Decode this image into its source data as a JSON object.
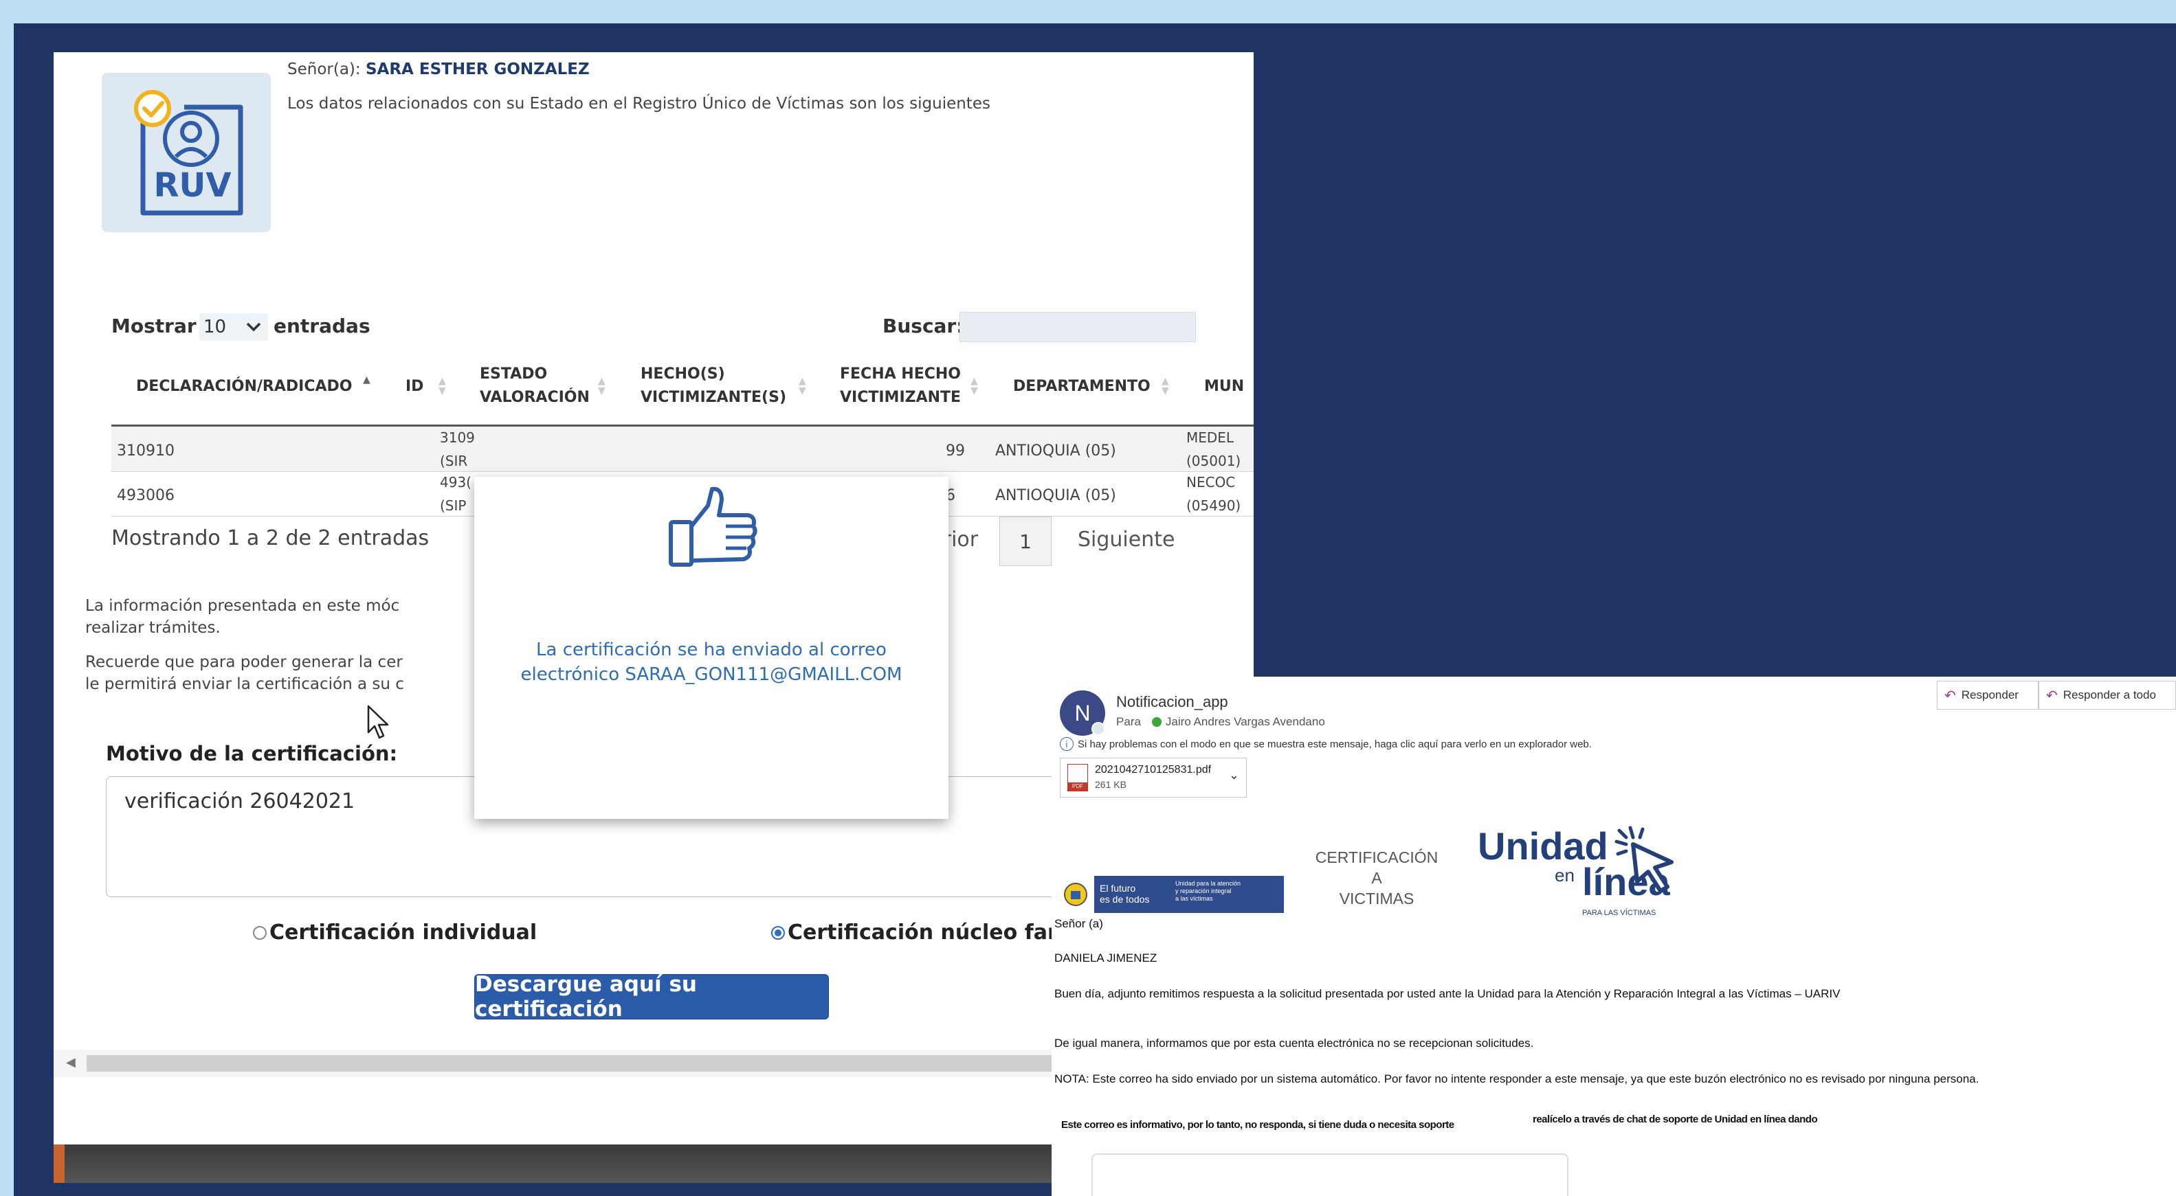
{
  "ruv": {
    "greeting_prefix": "Señor(a):",
    "person_name": "SARA ESTHER GONZALEZ",
    "intro_text": "Los datos relacionados con su Estado en el Registro Único de Víctimas son los siguientes",
    "logo_text": "RUV",
    "show_label": "Mostrar",
    "show_value": "10",
    "entries_label": "entradas",
    "search_label": "Buscar:",
    "search_value": "",
    "columns": [
      {
        "line1": "DECLARACIÓN/RADICADO",
        "line2": ""
      },
      {
        "line1": "ID",
        "line2": ""
      },
      {
        "line1": "ESTADO",
        "line2": "VALORACIÓN"
      },
      {
        "line1": "HECHO(S)",
        "line2": "VICTIMIZANTE(S)"
      },
      {
        "line1": "FECHA HECHO",
        "line2": "VICTIMIZANTE"
      },
      {
        "line1": "DEPARTAMENTO",
        "line2": ""
      },
      {
        "line1": "MUN",
        "line2": ""
      }
    ],
    "rows": [
      {
        "radicado": "310910",
        "id_line1": "3109",
        "id_line2": "(SIR",
        "fecha": "99",
        "departamento": "ANTIOQUIA (05)",
        "mun_line1": "MEDEL",
        "mun_line2": "(05001)"
      },
      {
        "radicado": "493006",
        "id_line1": "493(",
        "id_line2": "(SIP",
        "fecha": "6",
        "departamento": "ANTIOQUIA (05)",
        "mun_line1": "NECOC",
        "mun_line2": "(05490)"
      }
    ],
    "showing_text": "Mostrando 1 a 2 de 2 entradas",
    "pagination": {
      "prev": "Anterior",
      "page": "1",
      "next": "Siguiente"
    },
    "note1_line1": "La información presentada en este móc                                                   onstituye un documento viable para",
    "note1_line2": "realizar trámites.",
    "note2_line1": "Recuerde que para poder generar la cer                                                   electrónico actualizados, este último",
    "note2_line2": "le permitirá enviar la certificación a su c",
    "motive_label": "Motivo de la certificación:",
    "motive_value": "verificación 26042021",
    "radio_individual": "Certificación individual",
    "radio_family": "Certificación núcleo famili",
    "download_button": "Descargue aquí su certificación"
  },
  "modal": {
    "message_line1": "La certificación se ha enviado al correo",
    "message_line2": "electrónico SARAA_GON111@GMAILL.COM"
  },
  "email": {
    "avatar_initial": "N",
    "sender": "Notificacion_app",
    "to_label": "Para",
    "recipient": "Jairo Andres Vargas Avendano",
    "reply_label": "Responder",
    "reply_all_label": "Responder a todo",
    "warning": "Si hay problemas con el modo en que se muestra este mensaje, haga clic aquí para verlo en un explorador web.",
    "attachment_name": "2021042710125831.pdf",
    "attachment_size": "261 KB",
    "banner_line1": "El futuro",
    "banner_line2": "es de todos",
    "banner_sub1": "Unidad para la atención",
    "banner_sub2": "y reparación integral",
    "banner_sub3": "a las víctimas",
    "cert_title_line1": "CERTIFICACIÓN A",
    "cert_title_line2": "VICTIMAS",
    "logo_unidad": "Unidad",
    "logo_en": "en",
    "logo_linea": "línea",
    "logo_para": "PARA LAS VÍCTIMAS",
    "salutation": "Señor (a)",
    "recipient_name": "DANIELA JIMENEZ",
    "body1": "Buen día, adjunto remitimos respuesta a la solicitud presentada por usted ante la Unidad para la Atención y Reparación Integral a las Víctimas – UARIV",
    "body2": "De igual manera, informamos que por esta cuenta electrónica no se recepcionan solicitudes.",
    "body3": "NOTA: Este correo ha sido enviado por un sistema automático. Por favor no intente responder a este mensaje, ya que este buzón electrónico no es revisado por ninguna persona.",
    "footer_left": "Este correo es informativo, por lo tanto, no responda, si tiene duda o necesita soporte",
    "footer_right": "realícelo a través de chat de soporte de Unidad en línea dando"
  }
}
